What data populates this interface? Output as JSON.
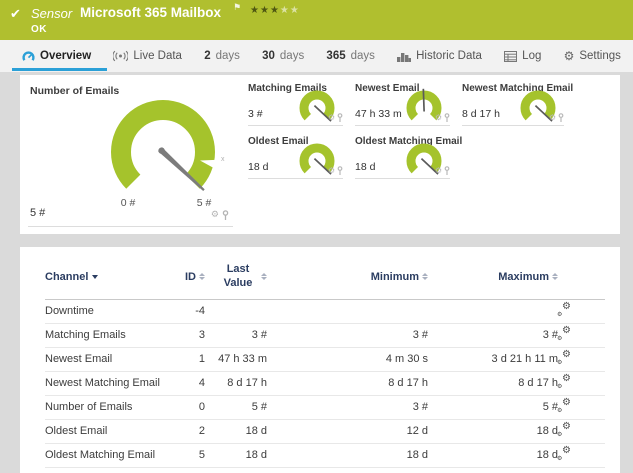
{
  "header": {
    "kind_label": "Sensor",
    "title": "Microsoft 365 Mailbox",
    "status": "OK",
    "stars_filled": 3,
    "stars_total": 5,
    "band_color": "#b0bf2f"
  },
  "tabs": [
    {
      "label": "Overview",
      "active": true
    },
    {
      "label": "Live Data"
    },
    {
      "num": "2",
      "label": "days"
    },
    {
      "num": "30",
      "label": "days"
    },
    {
      "num": "365",
      "label": "days"
    },
    {
      "label": "Historic Data"
    },
    {
      "label": "Log"
    },
    {
      "label": "Settings"
    }
  ],
  "gauges": {
    "accent_color": "#a5c32c",
    "main": {
      "title": "Number of Emails",
      "value": "5 #",
      "scale_min": "0 #",
      "scale_max": "5 #",
      "needle_deg": 133
    },
    "minis": [
      {
        "title": "Matching Emails",
        "value": "3 #",
        "needle_deg": 133
      },
      {
        "title": "Newest Email",
        "value": "47 h 33 m",
        "needle_deg": -2
      },
      {
        "title": "Newest Matching Email",
        "value": "8 d 17 h",
        "needle_deg": 133
      },
      {
        "title": "Oldest Email",
        "value": "18 d",
        "needle_deg": 133
      },
      {
        "title": "Oldest Matching Email",
        "value": "18 d",
        "needle_deg": 133
      }
    ]
  },
  "table": {
    "columns": [
      "Channel",
      "ID",
      "Last Value",
      "Minimum",
      "Maximum"
    ],
    "rows": [
      {
        "channel": "Downtime",
        "id": "-4",
        "last": "",
        "min": "",
        "max": ""
      },
      {
        "channel": "Matching Emails",
        "id": "3",
        "last": "3 #",
        "min": "3 #",
        "max": "3 #"
      },
      {
        "channel": "Newest Email",
        "id": "1",
        "last": "47 h 33 m",
        "min": "4 m 30 s",
        "max": "3 d 21 h 11 m"
      },
      {
        "channel": "Newest Matching Email",
        "id": "4",
        "last": "8 d 17 h",
        "min": "8 d 17 h",
        "max": "8 d 17 h"
      },
      {
        "channel": "Number of Emails",
        "id": "0",
        "last": "5 #",
        "min": "3 #",
        "max": "5 #"
      },
      {
        "channel": "Oldest Email",
        "id": "2",
        "last": "18 d",
        "min": "12 d",
        "max": "18 d"
      },
      {
        "channel": "Oldest Matching Email",
        "id": "5",
        "last": "18 d",
        "min": "18 d",
        "max": "18 d"
      }
    ]
  },
  "chart_data": [
    {
      "type": "gauge",
      "title": "Number of Emails",
      "value": 5,
      "unit": "#",
      "scale": [
        0,
        5
      ]
    },
    {
      "type": "gauge",
      "title": "Matching Emails",
      "value": "3 #",
      "min": "3 #",
      "max": "3 #"
    },
    {
      "type": "gauge",
      "title": "Newest Email",
      "value": "47 h 33 m",
      "min": "4 m 30 s",
      "max": "3 d 21 h 11 m"
    },
    {
      "type": "gauge",
      "title": "Newest Matching Email",
      "value": "8 d 17 h",
      "min": "8 d 17 h",
      "max": "8 d 17 h"
    },
    {
      "type": "gauge",
      "title": "Oldest Email",
      "value": "18 d",
      "min": "12 d",
      "max": "18 d"
    },
    {
      "type": "gauge",
      "title": "Oldest Matching Email",
      "value": "18 d",
      "min": "18 d",
      "max": "18 d"
    }
  ]
}
